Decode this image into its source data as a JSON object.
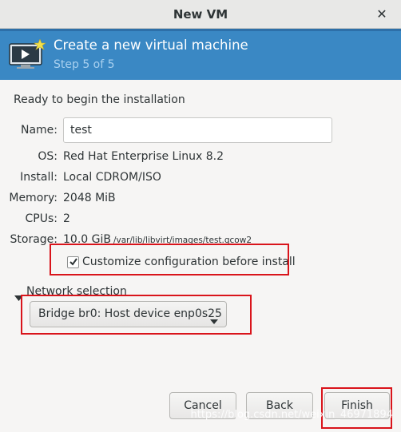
{
  "window": {
    "title": "New VM",
    "close_icon": "close-icon"
  },
  "header": {
    "title": "Create a new virtual machine",
    "step": "Step 5 of 5",
    "icon": "vm-monitor-icon",
    "accent_color": "#3a88c4"
  },
  "summary": {
    "heading": "Ready to begin the installation",
    "name_label": "Name:",
    "name_value": "test",
    "os_label": "OS:",
    "os_value": "Red Hat Enterprise Linux 8.2",
    "install_label": "Install:",
    "install_value": "Local CDROM/ISO",
    "memory_label": "Memory:",
    "memory_value": "2048 MiB",
    "cpus_label": "CPUs:",
    "cpus_value": "2",
    "storage_label": "Storage:",
    "storage_size": "10.0 GiB",
    "storage_path": "/var/lib/libvirt/images/test.qcow2"
  },
  "customize": {
    "label": "Customize configuration before install",
    "checked": true
  },
  "network": {
    "section_label": "Network selection",
    "selected": "Bridge br0: Host device enp0s25"
  },
  "buttons": {
    "cancel": "Cancel",
    "back": "Back",
    "finish": "Finish"
  },
  "watermark": "https://blog.csdn.net/weixin_46971894"
}
